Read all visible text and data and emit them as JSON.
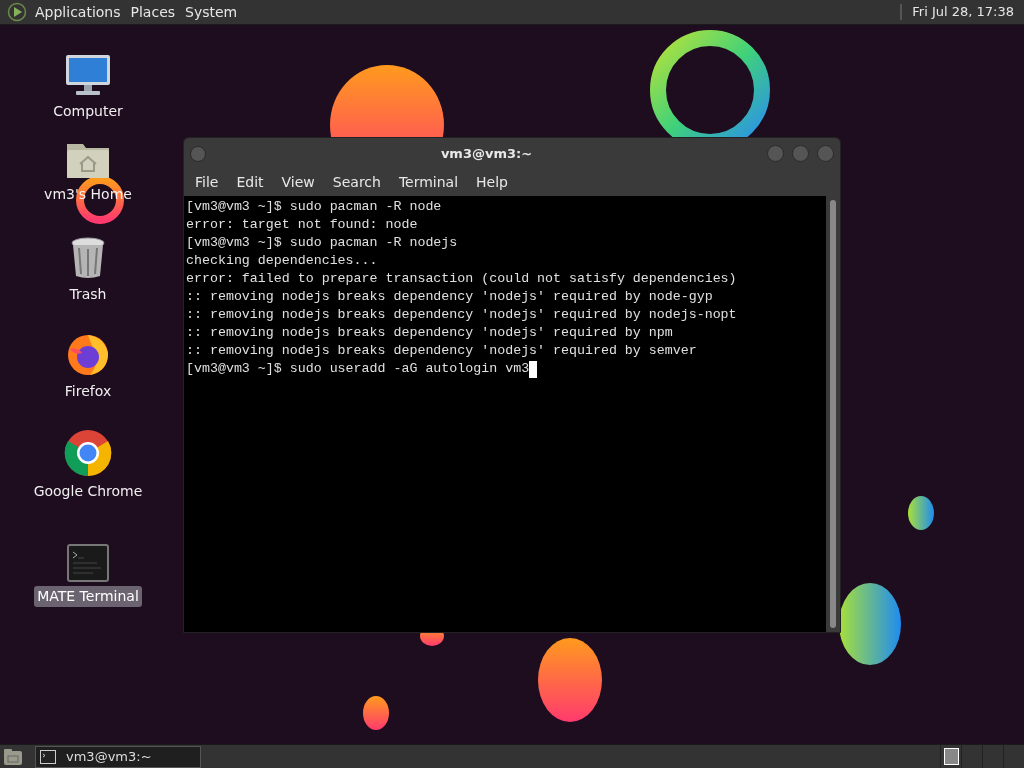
{
  "top_panel": {
    "menus": [
      "Applications",
      "Places",
      "System"
    ],
    "clock": "Fri Jul 28, 17:38"
  },
  "desktop_icons": [
    {
      "kind": "computer",
      "label": "Computer",
      "selected": false
    },
    {
      "kind": "home",
      "label": "vm3's Home",
      "selected": false
    },
    {
      "kind": "trash",
      "label": "Trash",
      "selected": false
    },
    {
      "kind": "firefox",
      "label": "Firefox",
      "selected": false
    },
    {
      "kind": "chrome",
      "label": "Google Chrome",
      "selected": false
    },
    {
      "kind": "terminal",
      "label": "MATE Terminal",
      "selected": true
    }
  ],
  "window": {
    "title": "vm3@vm3:~",
    "menu": [
      "File",
      "Edit",
      "View",
      "Search",
      "Terminal",
      "Help"
    ],
    "lines": [
      "[vm3@vm3 ~]$ sudo pacman -R node",
      "error: target not found: node",
      "[vm3@vm3 ~]$ sudo pacman -R nodejs",
      "checking dependencies...",
      "error: failed to prepare transaction (could not satisfy dependencies)",
      ":: removing nodejs breaks dependency 'nodejs' required by node-gyp",
      ":: removing nodejs breaks dependency 'nodejs' required by nodejs-nopt",
      ":: removing nodejs breaks dependency 'nodejs' required by npm",
      ":: removing nodejs breaks dependency 'nodejs' required by semver",
      "[vm3@vm3 ~]$ sudo useradd -aG autologin vm3"
    ]
  },
  "taskbar": {
    "windows": [
      {
        "title": "vm3@vm3:~",
        "selected": true
      }
    ],
    "workspaces": [
      {
        "selected": true
      },
      {
        "selected": false
      },
      {
        "selected": false
      },
      {
        "selected": false
      }
    ]
  }
}
